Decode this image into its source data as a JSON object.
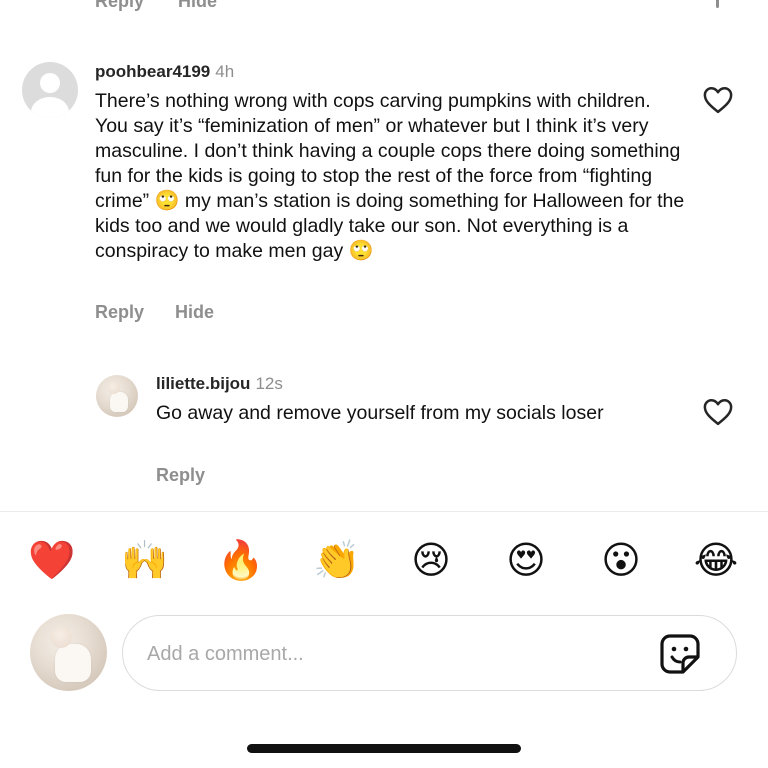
{
  "previous_comment": {
    "reply_label": "Reply",
    "hide_label": "Hide"
  },
  "comments": [
    {
      "username": "poohbear4199",
      "time": "4h",
      "text_parts": [
        "There’s nothing wrong with cops carving pumpkins with children. You say it’s “feminization of men” or whatever but I think it’s very masculine. I don’t think having a couple cops there doing something fun for the kids is going to stop the rest of the force from “fighting crime”",
        "🙄",
        "my man’s station is doing something for Halloween for the kids too and we would gladly take our son. Not everything is a conspiracy to make men gay",
        "🙄"
      ],
      "reply_label": "Reply",
      "hide_label": "Hide",
      "like_icon": "heart-outline-icon"
    },
    {
      "username": "liliette.bijou",
      "time": "12s",
      "text": "Go away and remove yourself from my socials loser",
      "reply_label": "Reply",
      "like_icon": "heart-outline-icon"
    }
  ],
  "quick_reactions": [
    {
      "name": "red-heart",
      "emoji": "❤️"
    },
    {
      "name": "raising-hands",
      "emoji": "🙌"
    },
    {
      "name": "fire",
      "emoji": "🔥"
    },
    {
      "name": "clapping-hands",
      "emoji": "👏"
    },
    {
      "name": "crying-face",
      "emoji": "😢"
    },
    {
      "name": "heart-eyes",
      "emoji": "😍"
    },
    {
      "name": "surprised-face",
      "emoji": "😮"
    },
    {
      "name": "tears-of-joy",
      "emoji": "😂"
    }
  ],
  "composer": {
    "placeholder": "Add a comment...",
    "value": "",
    "sticker_icon": "sticker-icon"
  },
  "colors": {
    "text": "#111111",
    "secondary": "#8e8e8e",
    "border": "#dbdbdb"
  }
}
